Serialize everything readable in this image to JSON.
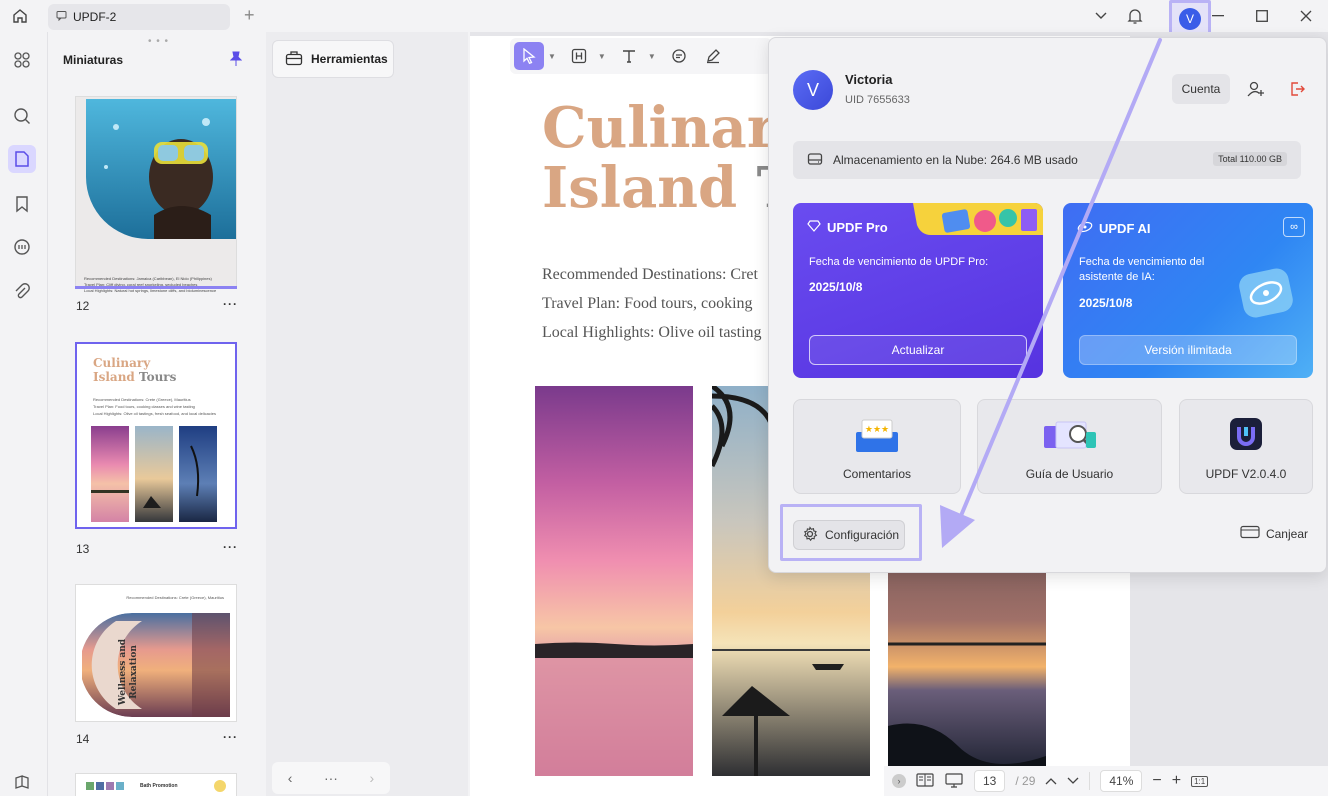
{
  "titlebar": {
    "tab_title": "UPDF-2",
    "avatar_initial": "V"
  },
  "thumbnails": {
    "title": "Miniaturas",
    "pages": [
      {
        "number": "12",
        "lines": [
          "Recommended Destinations: Jamaica (Caribbean), El Nido (Philippines)",
          "Travel Plan: Cliff diving, coral reef snorkeling, secluded beaches",
          "Local Highlights: Natural hot springs, limestone cliffs, and bioluminescence"
        ]
      },
      {
        "number": "13",
        "title_a": "Culinary",
        "title_b": "Island",
        "title_c": "Tours",
        "lines": [
          "Recommended Destinations: Crete (Greece), Mauritius",
          "Travel Plan: Food tours, cooking classes and wine tasting",
          "Local Highlights: Olive oil tastings, fresh seafood, and local delicacies"
        ]
      },
      {
        "number": "14",
        "header": "Recommended Destinations: Crete (Greece), Mauritius",
        "title": "Wellness and Relaxation"
      },
      {
        "number": "",
        "title": "Bath Promotion"
      }
    ]
  },
  "tools": {
    "label": "Herramientas"
  },
  "document": {
    "title_line1": "Culinary",
    "title_line2a": "Island",
    "title_line2b": "To",
    "lines": [
      "Recommended Destinations: Cret",
      "Travel Plan: Food tours, cooking",
      "Local Highlights: Olive oil tasting"
    ]
  },
  "status": {
    "current_page": "13",
    "total_pages": "/ 29",
    "zoom": "41%"
  },
  "account": {
    "initial": "V",
    "name": "Victoria",
    "uid": "UID 7655633",
    "account_button": "Cuenta",
    "storage_text": "Almacenamiento en la Nube: 264.6 MB usado",
    "storage_total": "Total 110.00 GB",
    "pro_card": {
      "title": "UPDF Pro",
      "label": "Fecha de vencimiento de UPDF Pro:",
      "date": "2025/10/8",
      "button": "Actualizar"
    },
    "ai_card": {
      "title": "UPDF AI",
      "label": "Fecha de vencimiento del asistente de IA:",
      "date": "2025/10/8",
      "button": "Versión ilimitada",
      "badge": "∞"
    },
    "tiles": [
      {
        "label": "Comentarios"
      },
      {
        "label": "Guía de Usuario"
      },
      {
        "label": "UPDF V2.0.4.0"
      }
    ],
    "config_button": "Configuración",
    "redeem": "Canjear"
  },
  "colors": {
    "accent": "#6f63ee",
    "pro": "#5a3ae6",
    "ai": "#3b78f3"
  }
}
